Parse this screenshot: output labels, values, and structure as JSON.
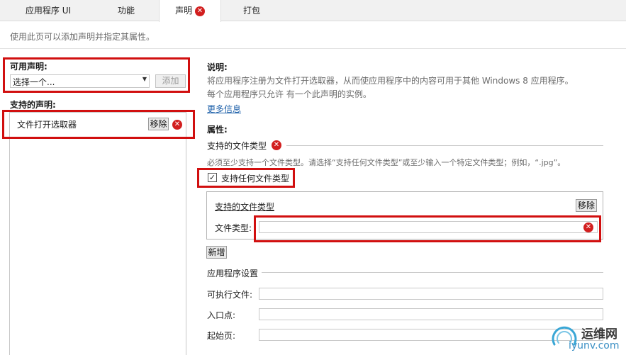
{
  "tabs": [
    {
      "label": "应用程序 UI"
    },
    {
      "label": "功能"
    },
    {
      "label": "声明"
    },
    {
      "label": "打包"
    }
  ],
  "page_description": "使用此页可以添加声明并指定其属性。",
  "available": {
    "title": "可用声明:",
    "select_value": "选择一个...",
    "add_button": "添加"
  },
  "supported": {
    "title": "支持的声明:",
    "items": [
      {
        "label": "文件打开选取器"
      }
    ],
    "remove_button": "移除"
  },
  "description": {
    "title": "说明:",
    "line1": "将应用程序注册为文件打开选取器，从而使应用程序中的内容可用于其他 Windows 8 应用程序。",
    "line2": "每个应用程序只允许 有一个此声明的实例。",
    "more_info": "更多信息"
  },
  "properties": {
    "title": "属性:",
    "supported_file_types_header": "支持的文件类型",
    "hint": "必须至少支持一个文件类型。请选择“支持任何文件类型”或至少输入一个特定文件类型；例如，“.jpg”。",
    "any_file_type_label": "支持任何文件类型",
    "group_title": "支持的文件类型",
    "group_remove_button": "移除",
    "file_type_label": "文件类型:",
    "file_type_value": "",
    "add_new_button": "新增"
  },
  "app_settings": {
    "title": "应用程序设置",
    "executable_label": "可执行文件:",
    "executable_value": "",
    "entry_point_label": "入口点:",
    "entry_point_value": "",
    "start_page_label": "起始页:",
    "start_page_value": ""
  },
  "watermark": {
    "brand": "运维网",
    "url": "iyunv.com"
  },
  "colors": {
    "highlight": "#d10f0f",
    "error": "#d21f1f",
    "link": "#1a5ea8"
  }
}
